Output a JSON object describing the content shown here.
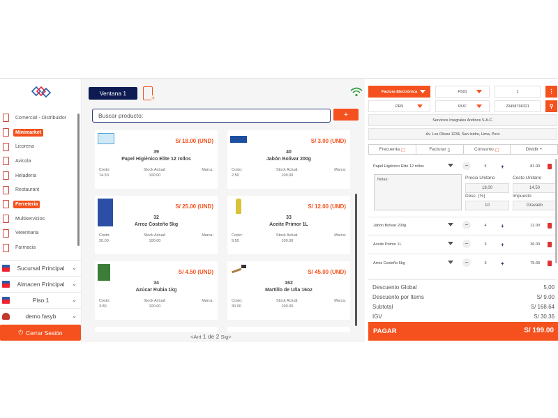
{
  "sidebar": {
    "categories": [
      {
        "label": "Comercial - Distribuidor",
        "active": false
      },
      {
        "label": "Minimarket",
        "active": true
      },
      {
        "label": "Licoreria",
        "active": false
      },
      {
        "label": "Avicola",
        "active": false
      },
      {
        "label": "Heladeria",
        "active": false
      },
      {
        "label": "Restaurant",
        "active": false
      },
      {
        "label": "Ferreteria",
        "active": true
      },
      {
        "label": "Multiservicios",
        "active": false
      },
      {
        "label": "Veterinaria",
        "active": false
      },
      {
        "label": "Farmacia",
        "active": false
      }
    ],
    "selects": {
      "sucursal": "Sucursal Principal",
      "almacen": "Almacen Principal",
      "piso": "Piso 1",
      "user": "demo fasyb"
    },
    "logout_label": "Cerrar Sesión"
  },
  "center": {
    "window_tab": "Ventana 1",
    "search_placeholder": "Buscar producto:",
    "add_label": "+",
    "products": [
      {
        "price": "S/ 18.00 (UND)",
        "code": "39",
        "name": "Papel Higiénico Elite 12 rollos",
        "cost_label": "Costo:",
        "cost": "14.50",
        "stock_label": "Stock Actual:",
        "stock": "100.00",
        "brand_label": "Marca:"
      },
      {
        "price": "S/ 3.00 (UND)",
        "code": "40",
        "name": "Jabón Bolivar 200g",
        "cost_label": "Costo:",
        "cost": "2.50",
        "stock_label": "Stock Actual:",
        "stock": "100.00",
        "brand_label": "Marca:"
      },
      {
        "price": "S/ 25.00 (UND)",
        "code": "32",
        "name": "Arroz Costeño 5kg",
        "cost_label": "Costo:",
        "cost": "20.00",
        "stock_label": "Stock Actual:",
        "stock": "100.00",
        "brand_label": "Marca:"
      },
      {
        "price": "S/ 12.00 (UND)",
        "code": "33",
        "name": "Aceite Primor 1L",
        "cost_label": "Costo:",
        "cost": "9.50",
        "stock_label": "Stock Actual:",
        "stock": "100.00",
        "brand_label": "Marca:"
      },
      {
        "price": "S/ 4.50 (UND)",
        "code": "34",
        "name": "Azúcar Rubia 1kg",
        "cost_label": "Costo:",
        "cost": "3.80",
        "stock_label": "Stock Actual:",
        "stock": "100.00",
        "brand_label": "Marca:"
      },
      {
        "price": "S/ 45.00 (UND)",
        "code": "162",
        "name": "Martillo de Uña 16oz",
        "cost_label": "Costo:",
        "cost": "30.00",
        "stock_label": "Stock Actual:",
        "stock": "100.00",
        "brand_label": "Marca:"
      }
    ],
    "pager": {
      "prev": "<Ant",
      "page": "1 de 2",
      "next": "Sig>"
    }
  },
  "right": {
    "doc_type": "Factura Electrónica",
    "series": "FS01",
    "number": "1",
    "currency": "PEN",
    "id_type": "RUC",
    "id_number": "20458796321",
    "client_name": "Servicios Integrales Andinos S.A.C.",
    "client_address": "Av. Los Olivos 1234, San Isidro, Lima, Perú",
    "tabs": [
      "Frecuenta",
      "Facturar",
      "Consumo",
      "Dividir"
    ],
    "items": [
      {
        "name": "Papel Higiénico Elite 12 rollos",
        "qty": "5",
        "amount": "81.00"
      },
      {
        "name": "Jabón Bolivar 200g",
        "qty": "4",
        "amount": "12.00"
      },
      {
        "name": "Aceite Primor 1L",
        "qty": "3",
        "amount": "36.00"
      },
      {
        "name": "Arroz Costeño 5kg",
        "qty": "3",
        "amount": "75.00"
      }
    ],
    "detail": {
      "notes_label": "Notas:",
      "unit_price_label": "Precio Unitario",
      "unit_price": "18,00",
      "unit_cost_label": "Costo Unitario",
      "unit_cost": "14,50",
      "discount_label": "Desc. (%)",
      "discount": "10",
      "tax_label": "Impuesto",
      "tax": "Gravado"
    },
    "totals": [
      {
        "label": "Descuento Global",
        "value": "5,00"
      },
      {
        "label": "Descuento por Items",
        "value": "S/ 9.00"
      },
      {
        "label": "Subtotal",
        "value": "S/ 168.64"
      },
      {
        "label": "IGV",
        "value": "S/ 30.36"
      }
    ],
    "pay_label": "PAGAR",
    "pay_total": "S/ 199.00"
  }
}
